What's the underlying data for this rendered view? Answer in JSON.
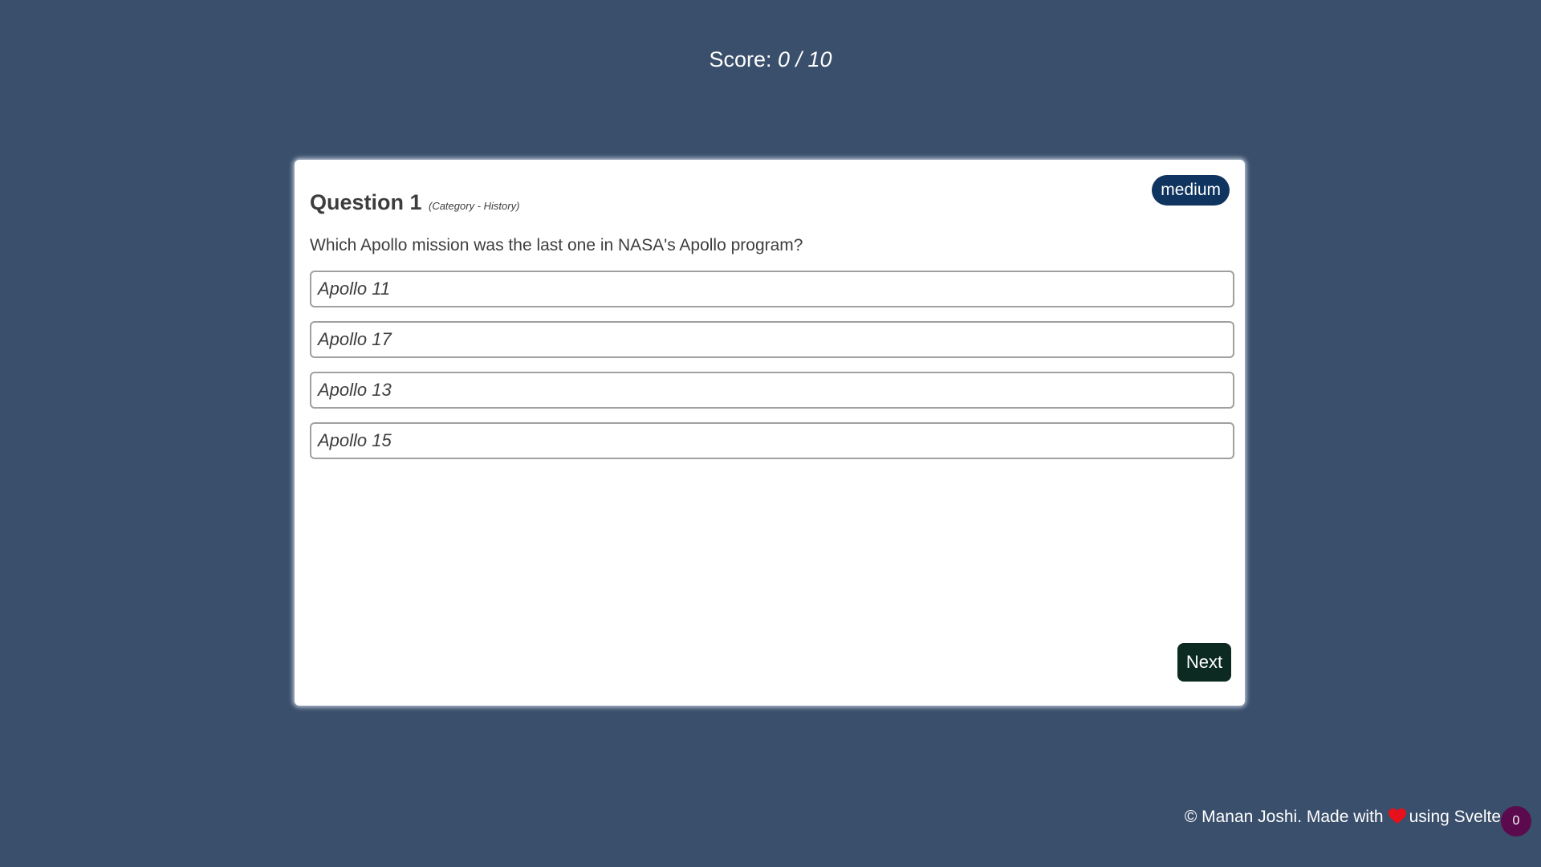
{
  "score": {
    "label": "Score: ",
    "value": "0 / 10"
  },
  "question": {
    "difficulty": "medium",
    "title": "Question 1",
    "category": "(Category - History)",
    "text": "Which Apollo mission was the last one in NASA's Apollo program?",
    "answers": [
      "Apollo 11",
      "Apollo 17",
      "Apollo 13",
      "Apollo 15"
    ],
    "next_label": "Next"
  },
  "footer": {
    "prefix": "© Manan Joshi. Made with",
    "suffix": "using Svelte",
    "heart_icon": "heart-icon",
    "heart_color": "#e8101a",
    "counter": "0"
  },
  "colors": {
    "background": "#3a4f6b",
    "badge": "#0f3460",
    "next_button": "#0c2a22",
    "counter_badge": "#5b0a4e"
  }
}
